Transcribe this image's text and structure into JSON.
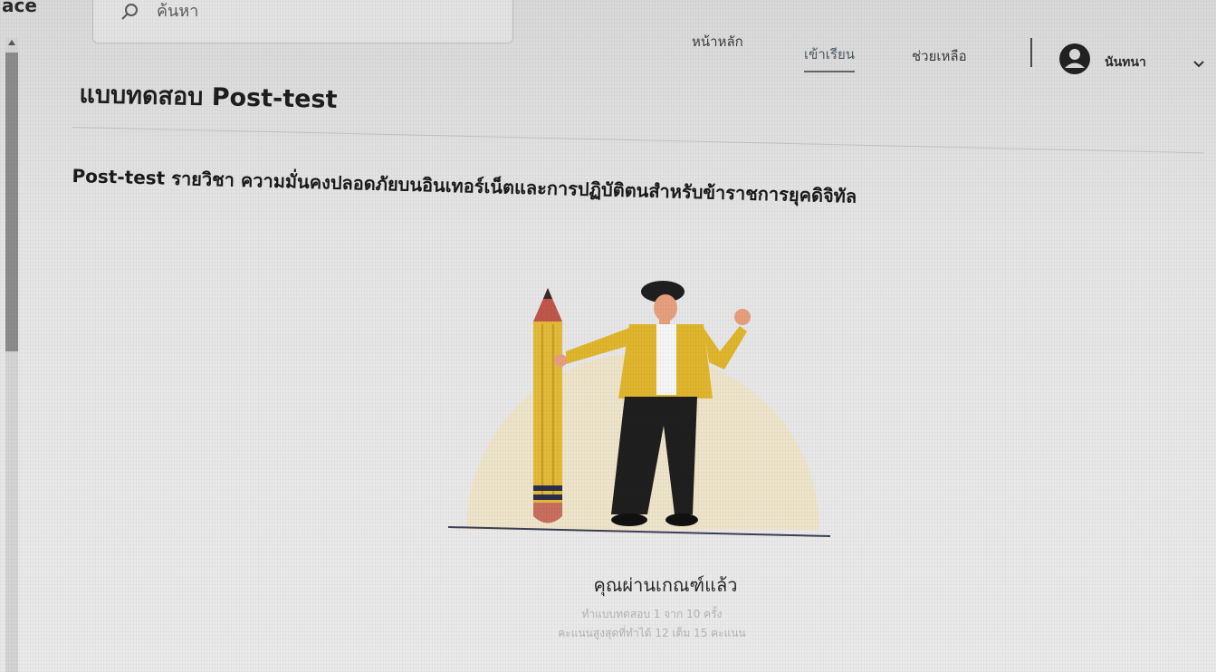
{
  "header": {
    "logo_fragment": "ace",
    "search": {
      "placeholder": "ค้นหา"
    },
    "nav": {
      "home": "หน้าหลัก",
      "courses": "เข้าเรียน",
      "help": "ช่วยเหลือ"
    },
    "user": {
      "name": "นันทนา"
    }
  },
  "main": {
    "page_title": "แบบทดสอบ Post-test",
    "course_title": "Post-test รายวิชา ความมั่นคงปลอดภัยบนอินเทอร์เน็ตและการปฏิบัติตนสำหรับข้าราชการยุคดิจิทัล",
    "result": {
      "title": "คุณผ่านเกณฑ์แล้ว",
      "attempts": "ทำแบบทดสอบ 1 จาก 10 ครั้ง",
      "best_score": "คะแนนสูงสุดที่ทำได้ 12 เต็ม 15 คะแนน"
    }
  },
  "colors": {
    "shirt": "#e0b62d",
    "pencil": "#e3bb3a",
    "pencil_tip": "#c0574a",
    "pants": "#1f1f1f",
    "ground_circle": "#efe4c3"
  },
  "icons": {
    "search": "search-icon",
    "user": "user-avatar-icon",
    "chevron": "chevron-down-icon"
  }
}
